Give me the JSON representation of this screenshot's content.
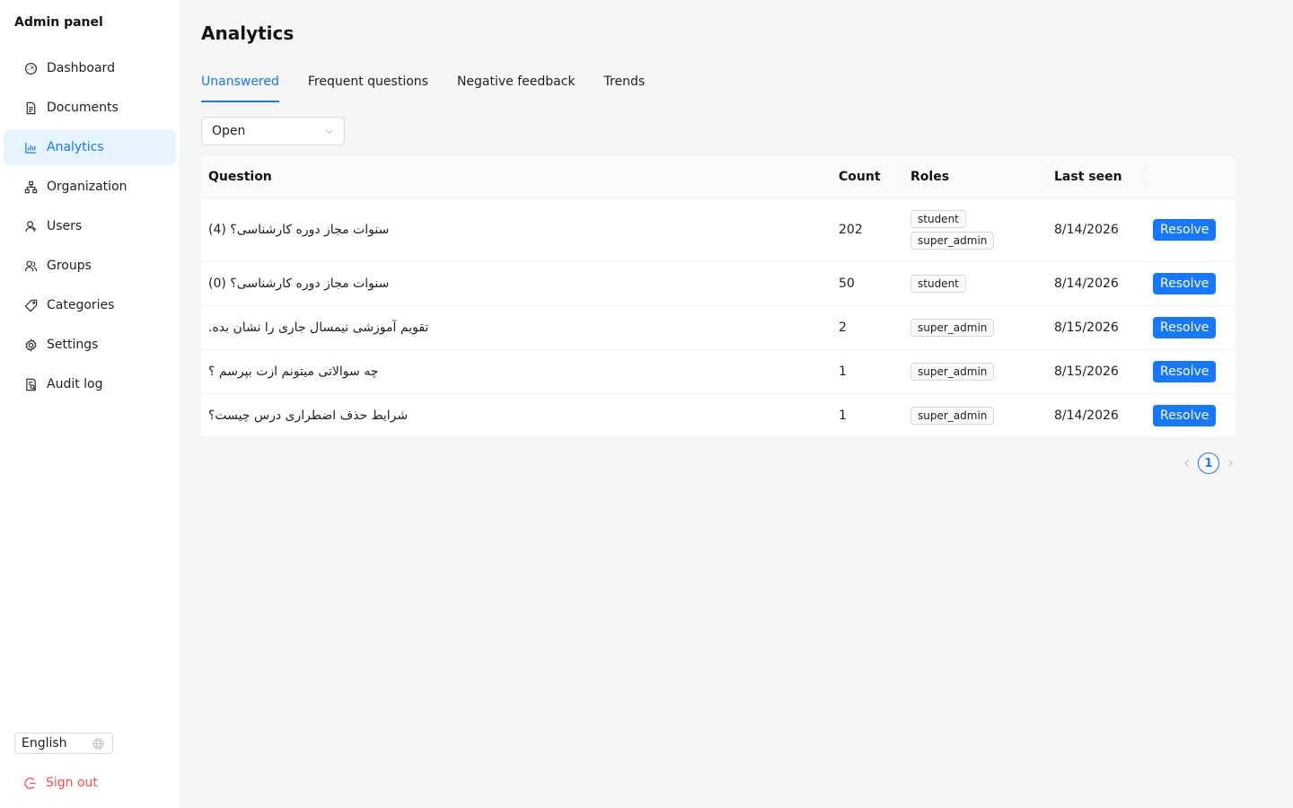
{
  "sidebar": {
    "title": "Admin panel",
    "items": [
      {
        "label": "Dashboard",
        "icon": "dashboard-icon"
      },
      {
        "label": "Documents",
        "icon": "file-icon"
      },
      {
        "label": "Analytics",
        "icon": "bar-chart-icon",
        "active": true
      },
      {
        "label": "Organization",
        "icon": "org-chart-icon"
      },
      {
        "label": "Users",
        "icon": "user-icon"
      },
      {
        "label": "Groups",
        "icon": "team-icon"
      },
      {
        "label": "Categories",
        "icon": "tag-icon"
      },
      {
        "label": "Settings",
        "icon": "gear-icon"
      },
      {
        "label": "Audit log",
        "icon": "audit-icon"
      }
    ],
    "language": "English",
    "sign_out": "Sign out"
  },
  "main": {
    "title": "Analytics",
    "tabs": [
      {
        "label": "Unanswered",
        "active": true
      },
      {
        "label": "Frequent questions"
      },
      {
        "label": "Negative feedback"
      },
      {
        "label": "Trends"
      }
    ],
    "filter": {
      "value": "Open"
    },
    "table": {
      "headers": {
        "question": "Question",
        "count": "Count",
        "roles": "Roles",
        "last_seen": "Last seen"
      },
      "rows": [
        {
          "question": "سنوات مجاز دوره کارشناسی؟ (4)",
          "count": "202",
          "roles": [
            "student",
            "super_admin"
          ],
          "last_seen": "8/14/2026",
          "action": "Resolve"
        },
        {
          "question": "سنوات مجاز دوره کارشناسی؟ (0)",
          "count": "50",
          "roles": [
            "student"
          ],
          "last_seen": "8/14/2026",
          "action": "Resolve"
        },
        {
          "question": "تقویم آموزشی نیمسال جاری را نشان بده.",
          "count": "2",
          "roles": [
            "super_admin"
          ],
          "last_seen": "8/15/2026",
          "action": "Resolve"
        },
        {
          "question": "چه سوالاتی میتونم ازت بپرسم ؟",
          "count": "1",
          "roles": [
            "super_admin"
          ],
          "last_seen": "8/15/2026",
          "action": "Resolve"
        },
        {
          "question": "شرایط حذف اضطراری درس چیست؟",
          "count": "1",
          "roles": [
            "super_admin"
          ],
          "last_seen": "8/14/2026",
          "action": "Resolve"
        }
      ]
    },
    "pagination": {
      "current": "1"
    }
  },
  "colors": {
    "accent": "#1677ff",
    "active_bg": "#e6f4ff",
    "danger": "#ff4d4f"
  }
}
